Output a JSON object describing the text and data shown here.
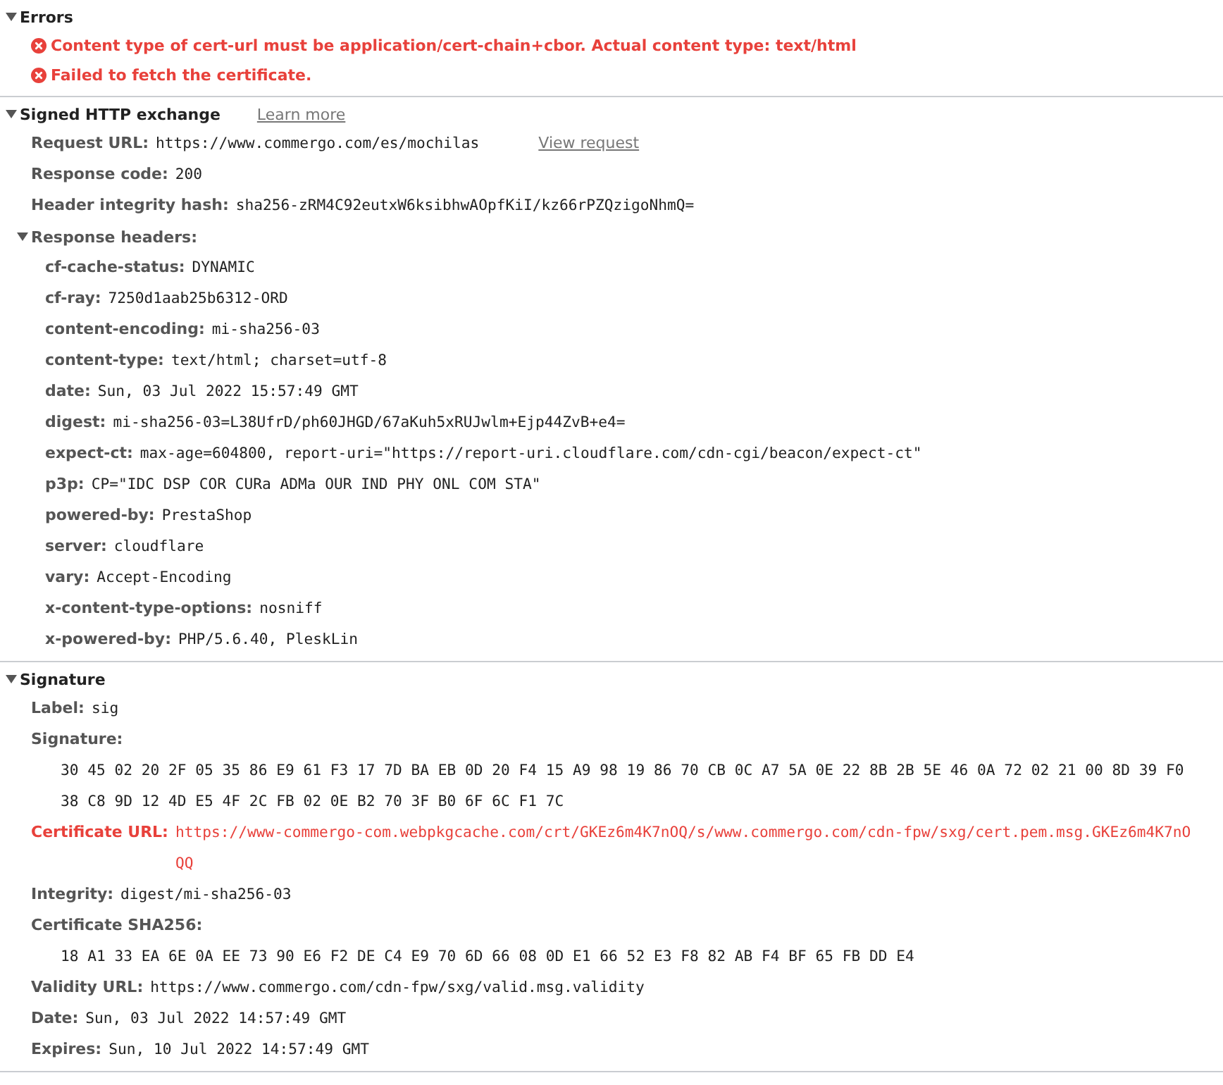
{
  "errors": {
    "title": "Errors",
    "expanded": true,
    "messages": [
      "Content type of cert-url must be application/cert-chain+cbor. Actual content type: text/html",
      "Failed to fetch the certificate."
    ]
  },
  "signed_exchange": {
    "title": "Signed HTTP exchange",
    "expanded": true,
    "learn_more": "Learn more",
    "fields": [
      {
        "label": "Request URL:",
        "value": "https://www.commergo.com/es/mochilas",
        "action": "View request"
      },
      {
        "label": "Response code:",
        "value": "200"
      },
      {
        "label": "Header integrity hash:",
        "value": "sha256-zRM4C92eutxW6ksibhwAOpfKiI/kz66rPZQzigoNhmQ="
      }
    ],
    "response_headers": {
      "title": "Response headers:",
      "expanded": true,
      "headers": [
        {
          "name": "cf-cache-status:",
          "value": "DYNAMIC"
        },
        {
          "name": "cf-ray:",
          "value": "7250d1aab25b6312-ORD"
        },
        {
          "name": "content-encoding:",
          "value": "mi-sha256-03"
        },
        {
          "name": "content-type:",
          "value": "text/html; charset=utf-8"
        },
        {
          "name": "date:",
          "value": "Sun, 03 Jul 2022 15:57:49 GMT"
        },
        {
          "name": "digest:",
          "value": "mi-sha256-03=L38UfrD/ph60JHGD/67aKuh5xRUJwlm+Ejp44ZvB+e4="
        },
        {
          "name": "expect-ct:",
          "value": "max-age=604800, report-uri=\"https://report-uri.cloudflare.com/cdn-cgi/beacon/expect-ct\""
        },
        {
          "name": "p3p:",
          "value": "CP=\"IDC DSP COR CURa ADMa OUR IND PHY ONL COM STA\""
        },
        {
          "name": "powered-by:",
          "value": "PrestaShop"
        },
        {
          "name": "server:",
          "value": "cloudflare"
        },
        {
          "name": "vary:",
          "value": "Accept-Encoding"
        },
        {
          "name": "x-content-type-options:",
          "value": "nosniff"
        },
        {
          "name": "x-powered-by:",
          "value": "PHP/5.6.40, PleskLin"
        }
      ]
    }
  },
  "signature": {
    "title": "Signature",
    "expanded": true,
    "fields": [
      {
        "kind": "inline",
        "label": "Label:",
        "value": "sig"
      },
      {
        "kind": "block",
        "label": "Signature:",
        "value": "30 45 02 20 2F 05 35 86 E9 61 F3 17 7D BA EB 0D 20 F4 15 A9 98 19 86 70 CB 0C A7 5A 0E 22 8B 2B 5E 46 0A 72 02 21 00 8D 39 F0 38 C8 9D 12 4D E5 4F 2C FB 02 0E B2 70 3F B0 6F 6C F1 7C"
      },
      {
        "kind": "error",
        "label": "Certificate URL:",
        "value": "https://www-commergo-com.webpkgcache.com/crt/GKEz6m4K7nOQ/s/www.commergo.com/cdn-fpw/sxg/cert.pem.msg.GKEz6m4K7nOQQ"
      },
      {
        "kind": "inline",
        "label": "Integrity:",
        "value": "digest/mi-sha256-03"
      },
      {
        "kind": "block",
        "label": "Certificate SHA256:",
        "value": "18 A1 33 EA 6E 0A EE 73 90 E6 F2 DE C4 E9 70 6D 66 08 0D E1 66 52 E3 F8 82 AB F4 BF 65 FB DD E4"
      },
      {
        "kind": "inline",
        "label": "Validity URL:",
        "value": "https://www.commergo.com/cdn-fpw/sxg/valid.msg.validity"
      },
      {
        "kind": "inline",
        "label": "Date:",
        "value": "Sun, 03 Jul 2022 14:57:49 GMT"
      },
      {
        "kind": "inline",
        "label": "Expires:",
        "value": "Sun, 10 Jul 2022 14:57:49 GMT"
      }
    ]
  }
}
